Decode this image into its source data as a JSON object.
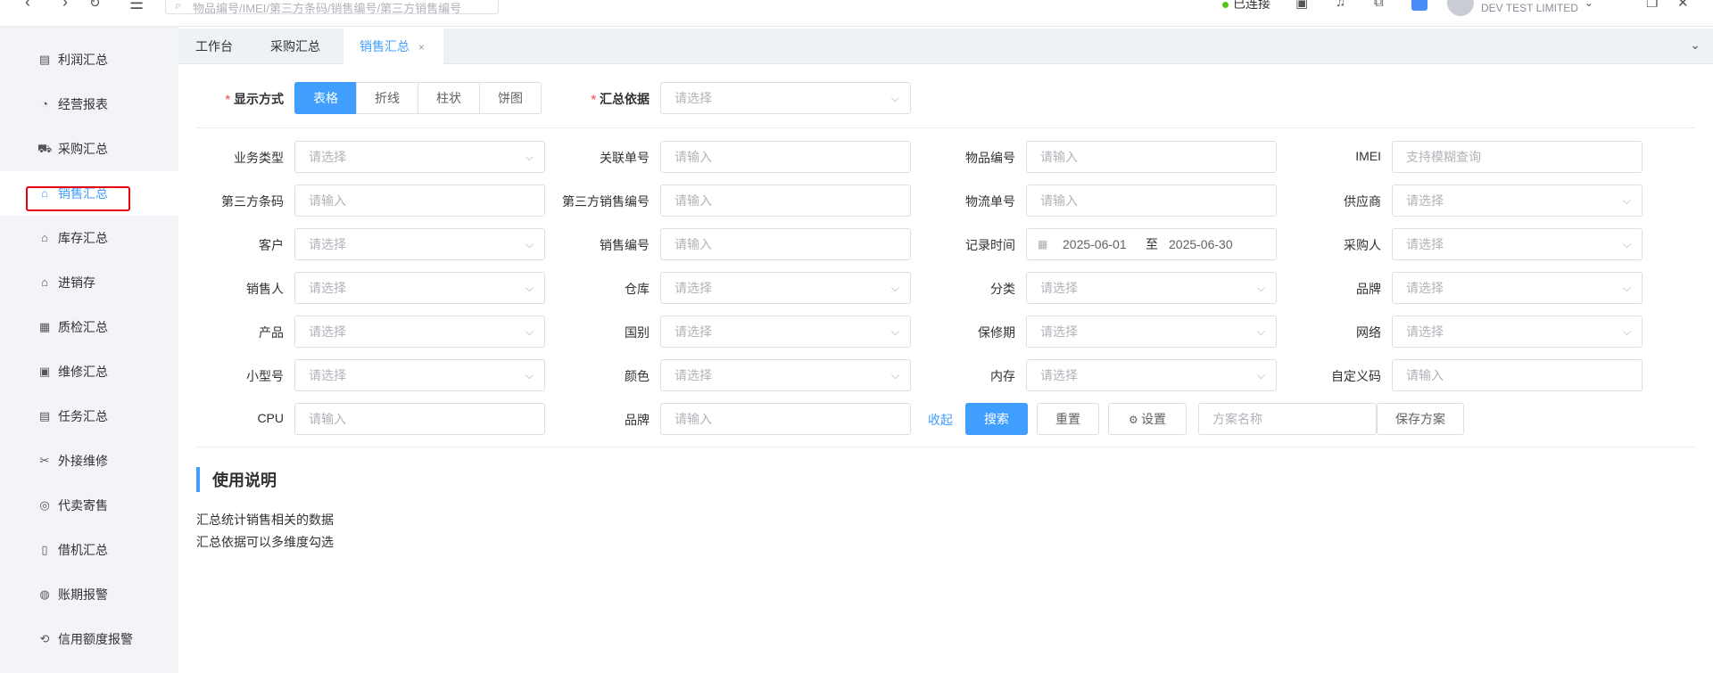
{
  "topbar": {
    "search_placeholder": "物品编号/IMEI/第三方条码/销售编号/第三方销售编号",
    "status": "已连接",
    "company": "DEV TEST LIMITED",
    "status_color": "#52c41a"
  },
  "sidebar": {
    "items": [
      {
        "label": "利润汇总",
        "icon": "report-icon"
      },
      {
        "label": "经营报表",
        "icon": "trend-icon"
      },
      {
        "label": "采购汇总",
        "icon": "cart-icon"
      },
      {
        "label": "销售汇总",
        "icon": "shop-icon"
      },
      {
        "label": "库存汇总",
        "icon": "home-icon"
      },
      {
        "label": "进销存",
        "icon": "warehouse-icon"
      },
      {
        "label": "质检汇总",
        "icon": "inspect-icon"
      },
      {
        "label": "维修汇总",
        "icon": "repair-icon"
      },
      {
        "label": "任务汇总",
        "icon": "task-icon"
      },
      {
        "label": "外接维修",
        "icon": "tools-icon"
      },
      {
        "label": "代卖寄售",
        "icon": "consign-icon"
      },
      {
        "label": "借机汇总",
        "icon": "device-icon"
      },
      {
        "label": "账期报警",
        "icon": "money-icon"
      },
      {
        "label": "信用额度报警",
        "icon": "credit-icon"
      }
    ],
    "active_index": 3
  },
  "tabs": [
    {
      "label": "工作台"
    },
    {
      "label": "采购汇总"
    },
    {
      "label": "销售汇总",
      "close": "×"
    }
  ],
  "display": {
    "label": "显示方式",
    "options": [
      "表格",
      "折线",
      "柱状",
      "饼图"
    ],
    "selected": "表格"
  },
  "summary_basis": {
    "label": "汇总依据",
    "placeholder": "请选择"
  },
  "required_mark": "*",
  "filters": [
    [
      {
        "label": "业务类型",
        "placeholder": "请选择",
        "type": "select"
      },
      {
        "label": "关联单号",
        "placeholder": "请输入",
        "type": "input"
      },
      {
        "label": "物品编号",
        "placeholder": "请输入",
        "type": "input"
      },
      {
        "label": "IMEI",
        "placeholder": "支持模糊查询",
        "type": "input"
      }
    ],
    [
      {
        "label": "第三方条码",
        "placeholder": "请输入",
        "type": "input"
      },
      {
        "label": "第三方销售编号",
        "placeholder": "请输入",
        "type": "input"
      },
      {
        "label": "物流单号",
        "placeholder": "请输入",
        "type": "input"
      },
      {
        "label": "供应商",
        "placeholder": "请选择",
        "type": "select"
      }
    ],
    [
      {
        "label": "客户",
        "placeholder": "请选择",
        "type": "select"
      },
      {
        "label": "销售编号",
        "placeholder": "请输入",
        "type": "input"
      },
      {
        "label": "记录时间",
        "type": "daterange",
        "start": "2025-06-01",
        "separator": "至",
        "end": "2025-06-30"
      },
      {
        "label": "采购人",
        "placeholder": "请选择",
        "type": "select"
      }
    ],
    [
      {
        "label": "销售人",
        "placeholder": "请选择",
        "type": "select"
      },
      {
        "label": "仓库",
        "placeholder": "请选择",
        "type": "select"
      },
      {
        "label": "分类",
        "placeholder": "请选择",
        "type": "select"
      },
      {
        "label": "品牌",
        "placeholder": "请选择",
        "type": "select"
      }
    ],
    [
      {
        "label": "产品",
        "placeholder": "请选择",
        "type": "select"
      },
      {
        "label": "国别",
        "placeholder": "请选择",
        "type": "select"
      },
      {
        "label": "保修期",
        "placeholder": "请选择",
        "type": "select"
      },
      {
        "label": "网络",
        "placeholder": "请选择",
        "type": "select"
      }
    ],
    [
      {
        "label": "小型号",
        "placeholder": "请选择",
        "type": "select"
      },
      {
        "label": "颜色",
        "placeholder": "请选择",
        "type": "select"
      },
      {
        "label": "内存",
        "placeholder": "请选择",
        "type": "select"
      },
      {
        "label": "自定义码",
        "placeholder": "请输入",
        "type": "input"
      }
    ]
  ],
  "last_row": {
    "cpu": {
      "label": "CPU",
      "placeholder": "请输入"
    },
    "brand": {
      "label": "品牌",
      "placeholder": "请输入"
    },
    "collapse": "收起",
    "search": "搜索",
    "reset": "重置",
    "settings": "设置",
    "scheme_placeholder": "方案名称",
    "save": "保存方案"
  },
  "usage": {
    "title": "使用说明",
    "lines": [
      "汇总统计销售相关的数据",
      "汇总依据可以多维度勾选"
    ]
  },
  "colors": {
    "primary": "#409eff",
    "highlight": "#e60012",
    "required": "#f56c6c"
  }
}
